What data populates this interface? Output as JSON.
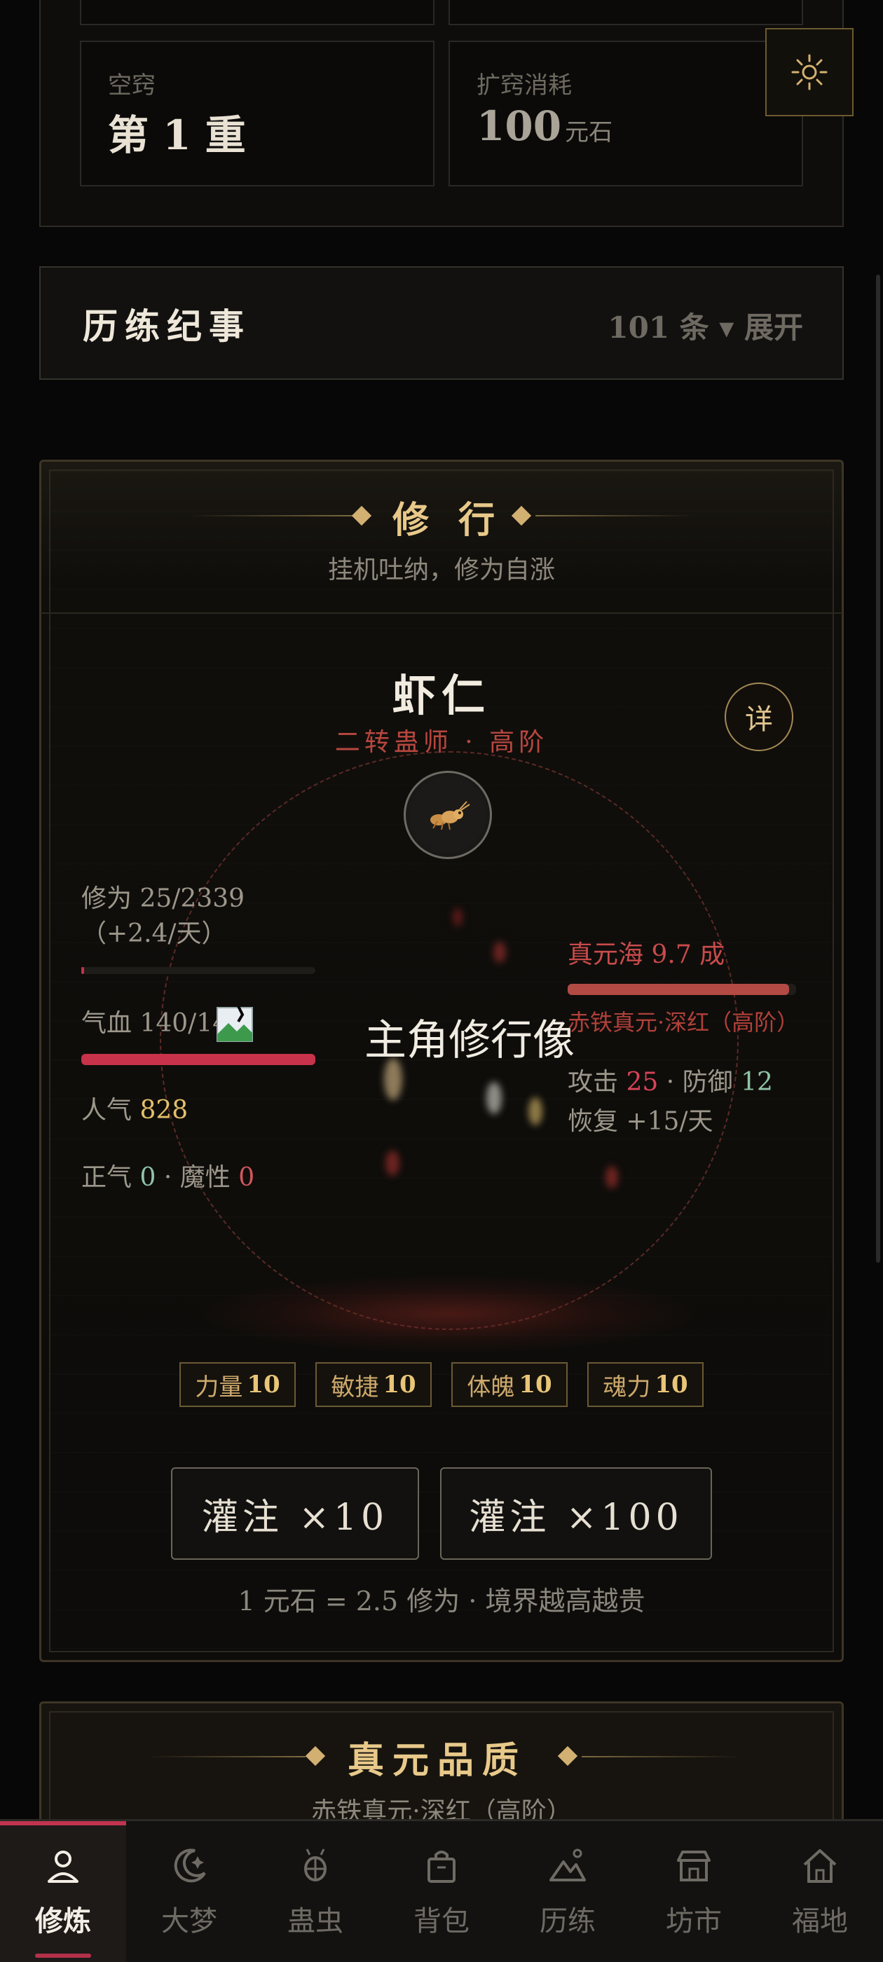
{
  "top_card": {
    "cell_left_label": "空窍",
    "cell_left_value": "第 1 重",
    "cell_right_label": "扩窍消耗",
    "cell_right_value": "100",
    "cell_right_unit": "元石"
  },
  "chronicle": {
    "title": "历练纪事",
    "count_text": "101 条 ▾ 展开"
  },
  "cultivation": {
    "title": "修 行",
    "subtitle": "挂机吐纳，修为自涨",
    "char_name": "虾仁",
    "char_rank": "二转蛊师 · 高阶",
    "detail_label": "详",
    "portrait_alt": "主角修行像",
    "cultivation_text": "修为 25/2339（+2.4/天）",
    "cultivation_progress": 0.011,
    "hp_text": "气血 140/140",
    "hp_progress": 1.0,
    "popularity_label": "人气",
    "popularity_value": "828",
    "righteous_label": "正气",
    "righteous_value": "0",
    "demonic_label": "魔性",
    "demonic_value": "0",
    "sea_label": "真元海",
    "sea_value": "9.7 成",
    "sea_progress": 0.97,
    "essence_desc": "赤铁真元·深红（高阶）",
    "attack_label": "攻击",
    "attack_value": "25",
    "defense_label": "防御",
    "defense_value": "12",
    "recovery_text": "恢复 +15/天",
    "attributes": [
      {
        "label": "力量",
        "value": "10"
      },
      {
        "label": "敏捷",
        "value": "10"
      },
      {
        "label": "体魄",
        "value": "10"
      },
      {
        "label": "魂力",
        "value": "10"
      }
    ],
    "pour_10_label": "灌注 ×10",
    "pour_100_label": "灌注 ×100",
    "rate_note": "1 元石 = 2.5 修为 · 境界越高越贵"
  },
  "essence_quality": {
    "title": "真元品质",
    "subtitle": "赤铁真元·深红（高阶）"
  },
  "nav": {
    "items": [
      {
        "label": "修炼",
        "icon": "person-icon",
        "active": true
      },
      {
        "label": "大梦",
        "icon": "moon-icon",
        "active": false
      },
      {
        "label": "蛊虫",
        "icon": "bug-icon",
        "active": false
      },
      {
        "label": "背包",
        "icon": "bag-icon",
        "active": false
      },
      {
        "label": "历练",
        "icon": "mountain-icon",
        "active": false
      },
      {
        "label": "坊市",
        "icon": "shop-icon",
        "active": false
      },
      {
        "label": "福地",
        "icon": "home-icon",
        "active": false
      }
    ]
  },
  "colors": {
    "accent_gold": "#e8c98a",
    "hp_red": "#c8324a",
    "nav_active": "#c1344f"
  }
}
